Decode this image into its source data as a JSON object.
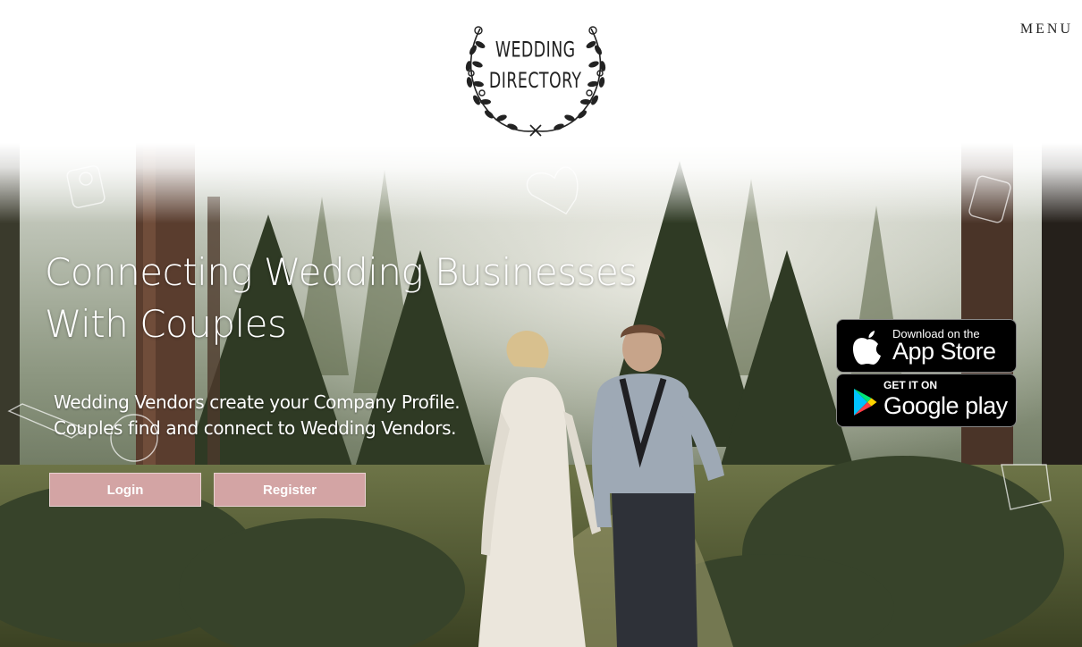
{
  "logo": {
    "line1": "WEDDING",
    "line2": "DIRECTORY"
  },
  "nav": {
    "menu_label": "MENU"
  },
  "hero": {
    "headline_line1": "Connecting Wedding Businesses",
    "headline_line2": "With Couples",
    "sub_line1": "Wedding Vendors create your Company Profile.",
    "sub_line2": "Couples find and connect to Wedding Vendors.",
    "login_label": "Login",
    "register_label": "Register"
  },
  "stores": {
    "apple_small": "Download on the",
    "apple_big": "App Store",
    "google_small": "GET IT ON",
    "google_big": "Google play"
  },
  "colors": {
    "button": "#d3a4a4",
    "forest_dark": "#2f3a24"
  }
}
